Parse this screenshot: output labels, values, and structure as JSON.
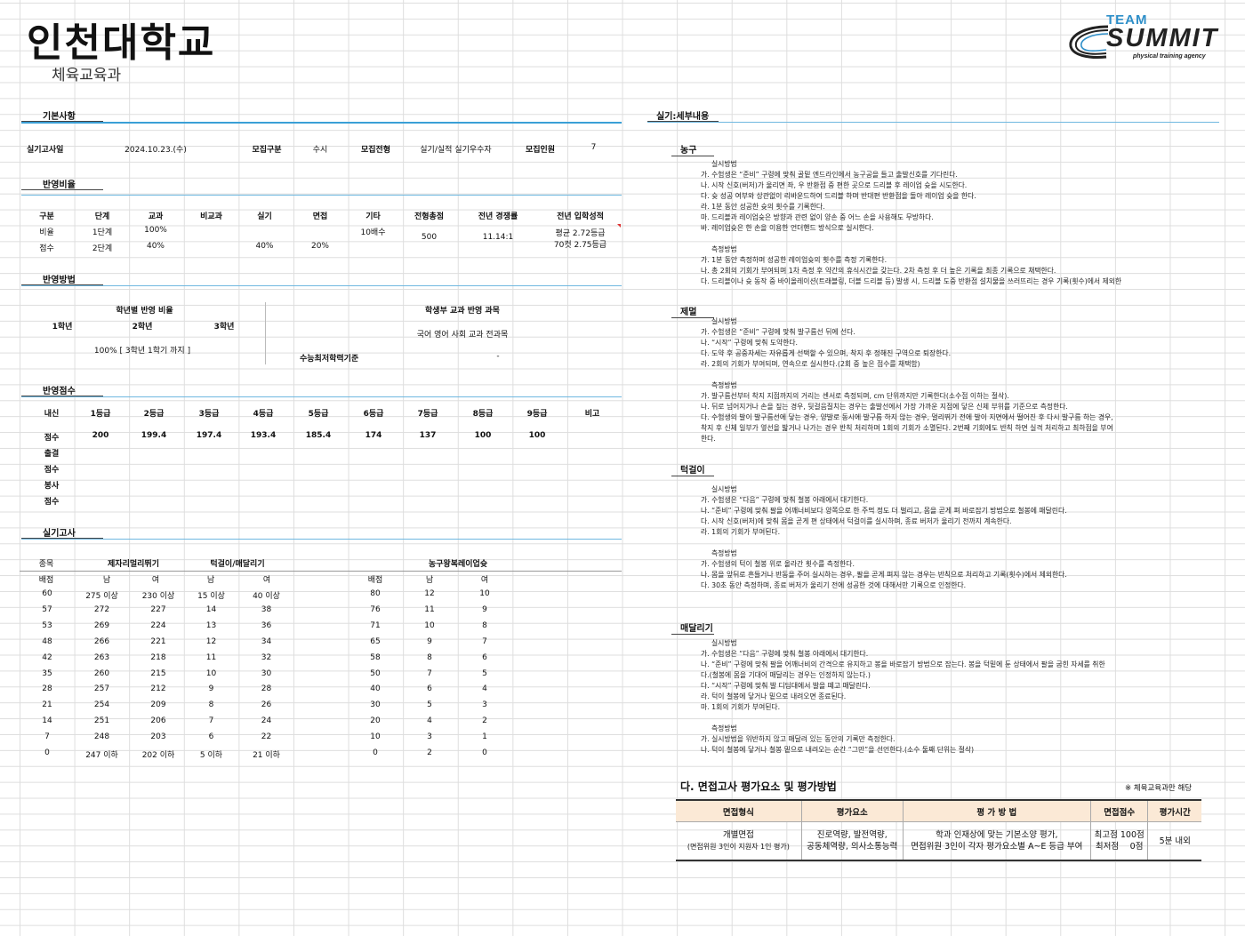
{
  "header": {
    "university": "인천대학교",
    "department": "체육교육과",
    "logo": {
      "team": "TEAM",
      "summit": "SUMMIT",
      "agency": "physical training agency"
    }
  },
  "basic": {
    "section": "기본사항",
    "exam_date_label": "실기고사일",
    "exam_date": "2024.10.23.(수)",
    "type_label": "모집구분",
    "type": "수시",
    "method_label": "모집전형",
    "method": "실기/실적 실기우수자",
    "quota_label": "모집인원",
    "quota": "7"
  },
  "ratio": {
    "section": "반영비율",
    "headers": [
      "구분",
      "단계",
      "교과",
      "비교과",
      "실기",
      "면접",
      "기타",
      "전형총점",
      "전년 경쟁률",
      "전년 입학성적"
    ],
    "row1": [
      "비율",
      "1단계",
      "100%",
      "",
      "",
      "",
      "10배수"
    ],
    "row2": [
      "점수",
      "2단계",
      "40%",
      "",
      "40%",
      "20%",
      ""
    ],
    "total": "500",
    "competition": "11.14:1",
    "admission1": "평균 2.72등급",
    "admission2": "70컷 2.75등급"
  },
  "method": {
    "section": "반영방법",
    "grade_title": "학년별 반영 비율",
    "years": [
      "1학년",
      "2학년",
      "3학년"
    ],
    "year_ratio": "100% [ 3학년 1학기 까지 ]",
    "subject_title": "학생부 교과 반영 과목",
    "subjects": "국어 영어 사회 교과 전과목",
    "minimum_label": "수능최저학력기준",
    "minimum": "-"
  },
  "score": {
    "section": "반영점수",
    "headers": [
      "내신",
      "1등급",
      "2등급",
      "3등급",
      "4등급",
      "5등급",
      "6등급",
      "7등급",
      "8등급",
      "9등급",
      "비고"
    ],
    "row_label": "점수",
    "values": [
      "200",
      "199.4",
      "197.4",
      "193.4",
      "185.4",
      "174",
      "137",
      "100",
      "100"
    ],
    "extra_rows": [
      "출결",
      "점수",
      "봉사",
      "점수"
    ]
  },
  "practical": {
    "section": "실기고사",
    "event_label": "종목",
    "events": [
      "제자리멀리뛰기",
      "턱걸이/매달리기",
      "농구왕복레이업슛"
    ],
    "score_label": "배점",
    "male": "남",
    "female": "여",
    "rows_left": [
      [
        "60",
        "275 이상",
        "230 이상",
        "15 이상",
        "40 이상"
      ],
      [
        "57",
        "272",
        "227",
        "14",
        "38"
      ],
      [
        "53",
        "269",
        "224",
        "13",
        "36"
      ],
      [
        "48",
        "266",
        "221",
        "12",
        "34"
      ],
      [
        "42",
        "263",
        "218",
        "11",
        "32"
      ],
      [
        "35",
        "260",
        "215",
        "10",
        "30"
      ],
      [
        "28",
        "257",
        "212",
        "9",
        "28"
      ],
      [
        "21",
        "254",
        "209",
        "8",
        "26"
      ],
      [
        "14",
        "251",
        "206",
        "7",
        "24"
      ],
      [
        "7",
        "248",
        "203",
        "6",
        "22"
      ],
      [
        "0",
        "247 이하",
        "202 이하",
        "5 이하",
        "21 이하"
      ]
    ],
    "rows_right": [
      [
        "80",
        "12",
        "10"
      ],
      [
        "76",
        "11",
        "9"
      ],
      [
        "71",
        "10",
        "8"
      ],
      [
        "65",
        "9",
        "7"
      ],
      [
        "58",
        "8",
        "6"
      ],
      [
        "50",
        "7",
        "5"
      ],
      [
        "40",
        "6",
        "4"
      ],
      [
        "30",
        "5",
        "3"
      ],
      [
        "20",
        "4",
        "2"
      ],
      [
        "10",
        "3",
        "1"
      ],
      [
        "0",
        "2",
        "0"
      ]
    ]
  },
  "details": {
    "section": "실기:세부내용",
    "basketball": {
      "title": "농구",
      "method_title": "실시방법",
      "method": [
        "가. 수험생은 “준비” 구령에 맞춰 골밑 엔드라인에서 농구공을 들고 출발신호를 기다린다.",
        "나. 시작 신호(버저)가 울리면 좌, 우 반환점 중 편한 곳으로 드리블 후 레이업 슛을 시도한다.",
        "다. 슛 성공 여부와 상관없이 리바운드하여 드리블 하며 반대편 반환점을 돌아 레이업 슛을 한다.",
        "라. 1분 동안 성공한 슛의 횟수를 기록한다.",
        "마. 드리블과 레이업슛은 방향과 관련 없이 양손 중 어느 손을 사용해도 무방하다.",
        "바. 레이업슛은 한 손을 이용한 언더핸드 방식으로 실시한다."
      ],
      "measure_title": "측정방법",
      "measure": [
        "가. 1분 동안 측정하며 성공한 레이업슛의 횟수를 측정 기록한다.",
        "나. 총 2회의 기회가 부여되며 1차 측정 후 약간의 휴식시간을 갖는다. 2차 측정 후 더 높은 기록을 최종 기록으로 채택한다.",
        "다. 드리블이나 슛 동작 중 바이올레이션(트래블링, 더블 드리블 등) 발생 시, 드리블 도중 반환점 설치물을 쓰러뜨리는 경우 기록(횟수)에서 제외한"
      ]
    },
    "jump": {
      "title": "제멀",
      "method_title": "실시방법",
      "method": [
        "가. 수험생은 “준비” 구령에 맞춰 발구름선 뒤에 선다.",
        "나. “시작” 구령에 맞춰 도약한다.",
        "다. 도약 후 공중자세는 자유롭게 선택할 수 있으며, 착지 후 정해진 구역으로 퇴장한다.",
        "라. 2회의 기회가 부여되며, 연속으로 실시한다.(2회 중 높은 점수를 채택함)"
      ],
      "measure_title": "측정방법",
      "measure": [
        "가. 발구름선부터 착지 지점까지의 거리는 센서로 측정되며, cm 단위까지만 기록한다(소수점 이하는 절삭).",
        "나. 뒤로 넘어지거나 손을 짚는 경우, 뒷걸음질치는 경우는 출발선에서 가장 가까운 지점에 닿은 신체 부위를 기준으로 측정한다.",
        "다. 수험생의 발이 발구름선에 닿는 경우, 양발로 동시에 발구름 하지 않는 경우, 멀리뛰기 전에 발이 지면에서 떨어진 후 다시 발구름 하는 경우,",
        "착지 후 신체 일부가 옆선을 밟거나 나가는 경우 반칙 처리하며 1회의 기회가 소멸된다. 2번째 기회에도 반칙 하면 실격 처리하고 최하점을 부여",
        "한다."
      ]
    },
    "pullup": {
      "title": "턱걸이",
      "method_title": "실시방법",
      "method": [
        "가. 수험생은 “다음” 구령에 맞춰 철봉 아래에서 대기한다.",
        "나. “준비” 구령에 맞춰 팔을 어깨너비보다 양쪽으로 한 주먹 정도 더 벌리고, 몸을 곧게 펴 바로잡기 방법으로 철봉에 매달린다.",
        "다. 시작 신호(버저)에 맞춰 몸을 곧게 편 상태에서 턱걸이를 실시하며, 종료 버저가 울리기 전까지 계속한다.",
        "라. 1회의 기회가 부여된다."
      ],
      "measure_title": "측정방법",
      "measure": [
        "가. 수험생의 턱이 철봉 위로 올라간 횟수를 측정한다.",
        "나. 몸을 앞뒤로 흔들거나 반동을 주어 실시하는 경우, 팔을 곧게 펴지 않는 경우는 반칙으로 처리하고 기록(횟수)에서 제외한다.",
        "다. 30초 동안 측정하며, 종료 버저가 울리기 전에 성공한 것에 대해서만 기록으로 인정한다."
      ]
    },
    "hang": {
      "title": "매달리기",
      "method_title": "실시방법",
      "method": [
        "가. 수험생은 “다음” 구령에 맞춰 철봉 아래에서 대기한다.",
        "나. “준비” 구령에 맞춰 팔을 어깨너비의 간격으로 유지하고 봉을 바로잡기 방법으로 잡는다. 봉을 턱밑에 둔 상태에서 팔을 굽힌 자세를 취한",
        "다.(철봉에 몸을 기대어 매달리는 경우는 인정하지 않는다.)",
        "다. “시작” 구령에 맞춰 발 디딤대에서 발을 떼고 매달린다.",
        "라. 턱이 철봉에 닿거나 밑으로 내려오면 종료된다.",
        "마. 1회의 기회가 부여된다."
      ],
      "measure_title": "측정방법",
      "measure": [
        "가. 실시방법을 위반하지 않고 매달려 있는 동안의 기록만 측정한다.",
        "나. 턱이 철봉에 닿거나 철봉 밑으로 내려오는 순간 “그만”을 선언한다.(소수 둘째 단위는 절삭)"
      ]
    }
  },
  "interview": {
    "title": "다. 면접고사 평가요소 및 평가방법",
    "note": "※ 체육교육과만 해당",
    "headers": [
      "면접형식",
      "평가요소",
      "평 가 방 법",
      "면접점수",
      "평가시간"
    ],
    "format1": "개별면접",
    "format2": "(면접위원 3인이 지원자 1인 평가)",
    "element1": "진로역량, 발전역량,",
    "element2": "공동체역량, 의사소통능력",
    "method1": "학과 인재상에 맞는 기본소양 평가,",
    "method2": "면접위원 3인이 각자 평가요소별 A~E 등급 부여",
    "score1": "최고점 100점",
    "score2": "최저점 　0점",
    "time": "5분 내외"
  }
}
